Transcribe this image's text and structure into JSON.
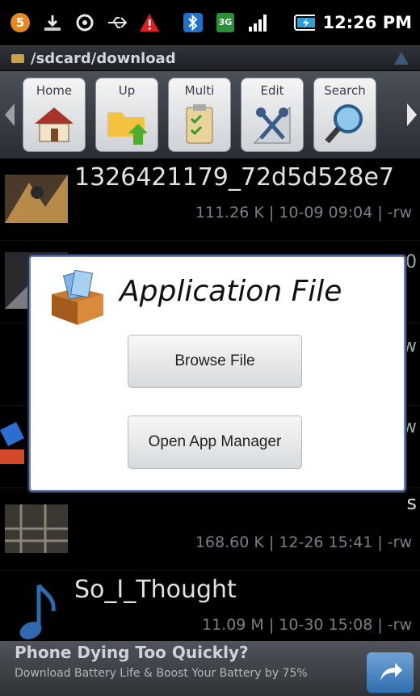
{
  "status_bar": {
    "time": "12:26 PM",
    "icons": [
      "notification-count-icon",
      "download-icon",
      "sync-icon",
      "usb-icon",
      "warning-icon",
      "bluetooth-icon",
      "network-3g-icon",
      "signal-icon",
      "battery-icon"
    ],
    "notification_count": "5"
  },
  "path_bar": {
    "path": "/sdcard/download"
  },
  "toolbar": {
    "buttons": [
      {
        "label": "Home",
        "icon": "home-icon"
      },
      {
        "label": "Up",
        "icon": "folder-up-icon"
      },
      {
        "label": "Multi",
        "icon": "multi-select-icon"
      },
      {
        "label": "Edit",
        "icon": "edit-icon"
      },
      {
        "label": "Search",
        "icon": "search-icon"
      }
    ]
  },
  "files": [
    {
      "name": "1326421179_72d5d528e7",
      "meta": "111.26 K | 10-09 09:04 | -rw",
      "thumb": "image-thumb"
    },
    {
      "name": "",
      "meta": "",
      "partial": "0"
    },
    {
      "name": "",
      "meta": "",
      "partial": "w"
    },
    {
      "name": "",
      "meta": "",
      "partial": "w"
    },
    {
      "name": "",
      "meta": "168.60 K | 12-26 15:41 | -rw",
      "partial": "s"
    },
    {
      "name": "So_I_Thought",
      "meta": "11.09 M | 10-30 15:08 | -rw",
      "thumb": "music-note-icon"
    }
  ],
  "dialog": {
    "title": "Application File",
    "browse_label": "Browse File",
    "open_manager_label": "Open App Manager"
  },
  "ad": {
    "title": "Phone Dying Too Quickly?",
    "subtitle": "Download Battery Life & Boost Your Battery by 75%"
  },
  "colors": {
    "dialog_border": "#6b7fb8",
    "toolbar_bg": "#3a3f46"
  }
}
